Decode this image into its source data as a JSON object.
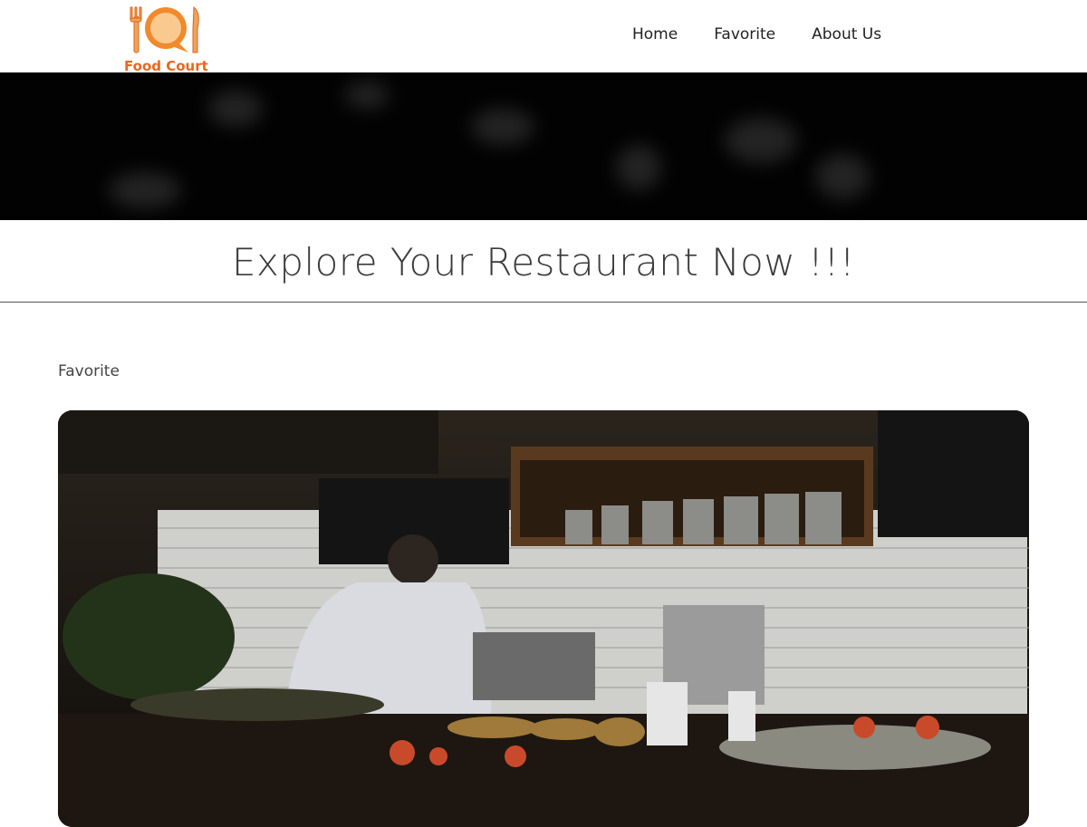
{
  "header": {
    "logo_text": "Food Court",
    "nav": [
      {
        "label": "Home"
      },
      {
        "label": "Favorite"
      },
      {
        "label": "About Us"
      }
    ]
  },
  "hero": {
    "title": "Explore Your Restaurant Now !!!"
  },
  "favorites": {
    "section_label": "Favorite"
  },
  "colors": {
    "brand_orange": "#e8671f",
    "hero_bg": "#020202"
  },
  "icons": [
    "fork-icon",
    "plate-bubble-icon",
    "knife-icon"
  ]
}
